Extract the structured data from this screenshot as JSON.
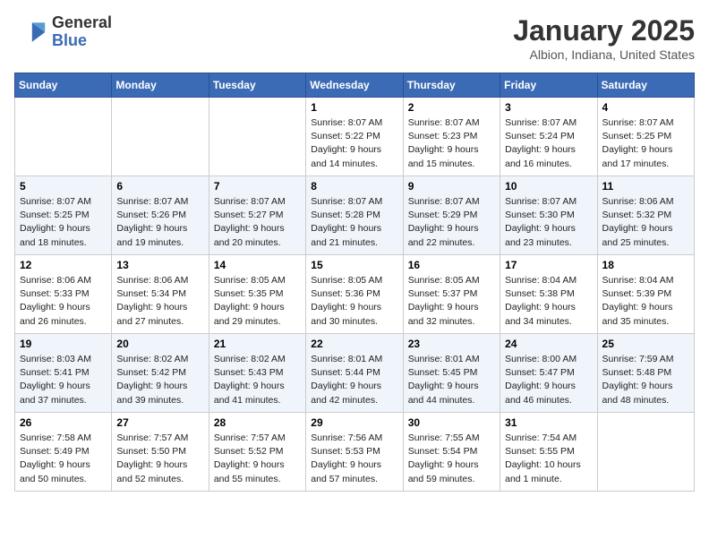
{
  "logo": {
    "general": "General",
    "blue": "Blue"
  },
  "header": {
    "month": "January 2025",
    "location": "Albion, Indiana, United States"
  },
  "days_of_week": [
    "Sunday",
    "Monday",
    "Tuesday",
    "Wednesday",
    "Thursday",
    "Friday",
    "Saturday"
  ],
  "weeks": [
    [
      {
        "day": "",
        "info": ""
      },
      {
        "day": "",
        "info": ""
      },
      {
        "day": "",
        "info": ""
      },
      {
        "day": "1",
        "sunrise": "Sunrise: 8:07 AM",
        "sunset": "Sunset: 5:22 PM",
        "daylight": "Daylight: 9 hours and 14 minutes."
      },
      {
        "day": "2",
        "sunrise": "Sunrise: 8:07 AM",
        "sunset": "Sunset: 5:23 PM",
        "daylight": "Daylight: 9 hours and 15 minutes."
      },
      {
        "day": "3",
        "sunrise": "Sunrise: 8:07 AM",
        "sunset": "Sunset: 5:24 PM",
        "daylight": "Daylight: 9 hours and 16 minutes."
      },
      {
        "day": "4",
        "sunrise": "Sunrise: 8:07 AM",
        "sunset": "Sunset: 5:25 PM",
        "daylight": "Daylight: 9 hours and 17 minutes."
      }
    ],
    [
      {
        "day": "5",
        "sunrise": "Sunrise: 8:07 AM",
        "sunset": "Sunset: 5:25 PM",
        "daylight": "Daylight: 9 hours and 18 minutes."
      },
      {
        "day": "6",
        "sunrise": "Sunrise: 8:07 AM",
        "sunset": "Sunset: 5:26 PM",
        "daylight": "Daylight: 9 hours and 19 minutes."
      },
      {
        "day": "7",
        "sunrise": "Sunrise: 8:07 AM",
        "sunset": "Sunset: 5:27 PM",
        "daylight": "Daylight: 9 hours and 20 minutes."
      },
      {
        "day": "8",
        "sunrise": "Sunrise: 8:07 AM",
        "sunset": "Sunset: 5:28 PM",
        "daylight": "Daylight: 9 hours and 21 minutes."
      },
      {
        "day": "9",
        "sunrise": "Sunrise: 8:07 AM",
        "sunset": "Sunset: 5:29 PM",
        "daylight": "Daylight: 9 hours and 22 minutes."
      },
      {
        "day": "10",
        "sunrise": "Sunrise: 8:07 AM",
        "sunset": "Sunset: 5:30 PM",
        "daylight": "Daylight: 9 hours and 23 minutes."
      },
      {
        "day": "11",
        "sunrise": "Sunrise: 8:06 AM",
        "sunset": "Sunset: 5:32 PM",
        "daylight": "Daylight: 9 hours and 25 minutes."
      }
    ],
    [
      {
        "day": "12",
        "sunrise": "Sunrise: 8:06 AM",
        "sunset": "Sunset: 5:33 PM",
        "daylight": "Daylight: 9 hours and 26 minutes."
      },
      {
        "day": "13",
        "sunrise": "Sunrise: 8:06 AM",
        "sunset": "Sunset: 5:34 PM",
        "daylight": "Daylight: 9 hours and 27 minutes."
      },
      {
        "day": "14",
        "sunrise": "Sunrise: 8:05 AM",
        "sunset": "Sunset: 5:35 PM",
        "daylight": "Daylight: 9 hours and 29 minutes."
      },
      {
        "day": "15",
        "sunrise": "Sunrise: 8:05 AM",
        "sunset": "Sunset: 5:36 PM",
        "daylight": "Daylight: 9 hours and 30 minutes."
      },
      {
        "day": "16",
        "sunrise": "Sunrise: 8:05 AM",
        "sunset": "Sunset: 5:37 PM",
        "daylight": "Daylight: 9 hours and 32 minutes."
      },
      {
        "day": "17",
        "sunrise": "Sunrise: 8:04 AM",
        "sunset": "Sunset: 5:38 PM",
        "daylight": "Daylight: 9 hours and 34 minutes."
      },
      {
        "day": "18",
        "sunrise": "Sunrise: 8:04 AM",
        "sunset": "Sunset: 5:39 PM",
        "daylight": "Daylight: 9 hours and 35 minutes."
      }
    ],
    [
      {
        "day": "19",
        "sunrise": "Sunrise: 8:03 AM",
        "sunset": "Sunset: 5:41 PM",
        "daylight": "Daylight: 9 hours and 37 minutes."
      },
      {
        "day": "20",
        "sunrise": "Sunrise: 8:02 AM",
        "sunset": "Sunset: 5:42 PM",
        "daylight": "Daylight: 9 hours and 39 minutes."
      },
      {
        "day": "21",
        "sunrise": "Sunrise: 8:02 AM",
        "sunset": "Sunset: 5:43 PM",
        "daylight": "Daylight: 9 hours and 41 minutes."
      },
      {
        "day": "22",
        "sunrise": "Sunrise: 8:01 AM",
        "sunset": "Sunset: 5:44 PM",
        "daylight": "Daylight: 9 hours and 42 minutes."
      },
      {
        "day": "23",
        "sunrise": "Sunrise: 8:01 AM",
        "sunset": "Sunset: 5:45 PM",
        "daylight": "Daylight: 9 hours and 44 minutes."
      },
      {
        "day": "24",
        "sunrise": "Sunrise: 8:00 AM",
        "sunset": "Sunset: 5:47 PM",
        "daylight": "Daylight: 9 hours and 46 minutes."
      },
      {
        "day": "25",
        "sunrise": "Sunrise: 7:59 AM",
        "sunset": "Sunset: 5:48 PM",
        "daylight": "Daylight: 9 hours and 48 minutes."
      }
    ],
    [
      {
        "day": "26",
        "sunrise": "Sunrise: 7:58 AM",
        "sunset": "Sunset: 5:49 PM",
        "daylight": "Daylight: 9 hours and 50 minutes."
      },
      {
        "day": "27",
        "sunrise": "Sunrise: 7:57 AM",
        "sunset": "Sunset: 5:50 PM",
        "daylight": "Daylight: 9 hours and 52 minutes."
      },
      {
        "day": "28",
        "sunrise": "Sunrise: 7:57 AM",
        "sunset": "Sunset: 5:52 PM",
        "daylight": "Daylight: 9 hours and 55 minutes."
      },
      {
        "day": "29",
        "sunrise": "Sunrise: 7:56 AM",
        "sunset": "Sunset: 5:53 PM",
        "daylight": "Daylight: 9 hours and 57 minutes."
      },
      {
        "day": "30",
        "sunrise": "Sunrise: 7:55 AM",
        "sunset": "Sunset: 5:54 PM",
        "daylight": "Daylight: 9 hours and 59 minutes."
      },
      {
        "day": "31",
        "sunrise": "Sunrise: 7:54 AM",
        "sunset": "Sunset: 5:55 PM",
        "daylight": "Daylight: 10 hours and 1 minute."
      },
      {
        "day": "",
        "info": ""
      }
    ]
  ]
}
